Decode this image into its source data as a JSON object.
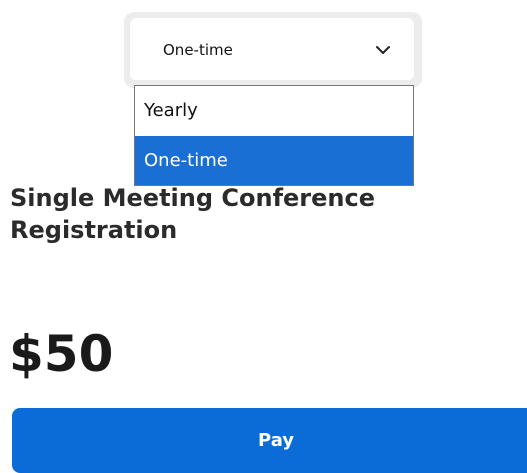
{
  "billing_select": {
    "selected_value": "One-time",
    "options": [
      {
        "label": "Yearly",
        "selected": false
      },
      {
        "label": "One-time",
        "selected": true
      }
    ]
  },
  "product": {
    "title": "Single Meeting Conference Registration",
    "price": "$50"
  },
  "actions": {
    "pay_label": "Pay"
  },
  "colors": {
    "accent": "#0b6cd8",
    "option_highlight": "#1a6fd4"
  },
  "icons": {
    "select_arrow": "chevron-down-icon"
  }
}
